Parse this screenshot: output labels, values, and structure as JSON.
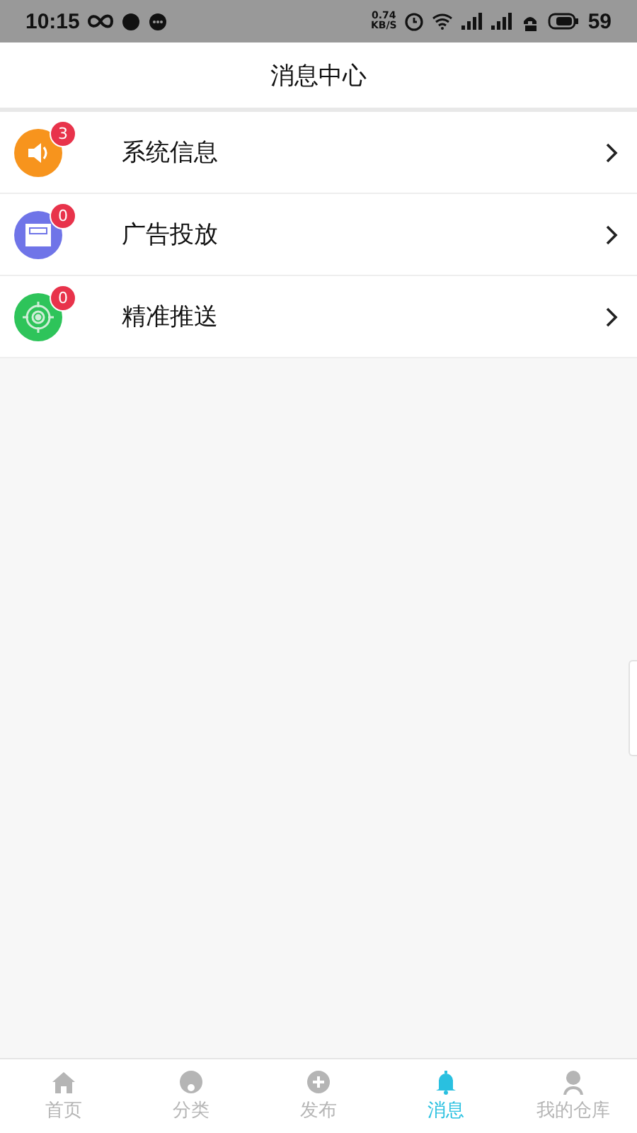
{
  "status_bar": {
    "time": "10:15",
    "speed": "0.74",
    "speed_unit": "KB/S",
    "battery": "59"
  },
  "header": {
    "title": "消息中心"
  },
  "items": [
    {
      "label": "系统信息",
      "badge": "3",
      "color": "#f7941d",
      "kind": "speaker"
    },
    {
      "label": "广告投放",
      "badge": "0",
      "color": "#6f74e8",
      "kind": "card"
    },
    {
      "label": "精准推送",
      "badge": "0",
      "color": "#2ec45a",
      "kind": "target"
    }
  ],
  "tabs": [
    {
      "label": "首页",
      "kind": "home",
      "selected": false
    },
    {
      "label": "分类",
      "kind": "category",
      "selected": false
    },
    {
      "label": "发布",
      "kind": "plus",
      "selected": false
    },
    {
      "label": "消息",
      "kind": "bell",
      "selected": true
    },
    {
      "label": "我的仓库",
      "kind": "person",
      "selected": false
    }
  ]
}
